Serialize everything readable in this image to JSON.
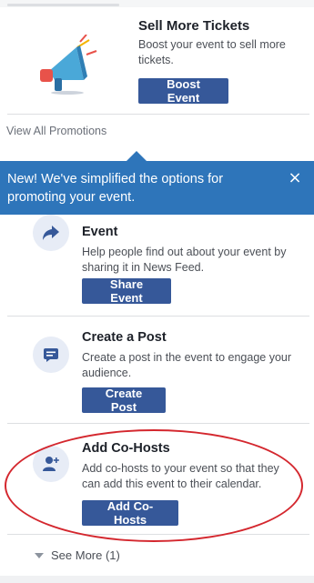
{
  "promo": {
    "title": "Sell More Tickets",
    "description": "Boost your event to sell more tickets.",
    "button_label": "Boost Event",
    "icon": "megaphone-icon"
  },
  "view_all_label": "View All Promotions",
  "tooltip": {
    "text": "New! We've simplified the options for promoting your event.",
    "close_symbol": "×"
  },
  "items": [
    {
      "title": "Event",
      "description": "Help people find out about your event by sharing it in News Feed.",
      "button_label": "Share Event",
      "icon": "share-arrow-icon"
    },
    {
      "title": "Create a Post",
      "description": "Create a post in the event to engage your audience.",
      "button_label": "Create Post",
      "icon": "post-icon"
    },
    {
      "title": "Add Co-Hosts",
      "description": "Add co-hosts to your event so that they can add this event to their calendar.",
      "button_label": "Add Co-Hosts",
      "icon": "add-person-icon"
    }
  ],
  "see_more_label": "See More (1)",
  "colors": {
    "button": "#365899",
    "tooltip": "#2e75ba",
    "icon_bg": "#e7ecf6",
    "annotation": "#d4272e"
  }
}
